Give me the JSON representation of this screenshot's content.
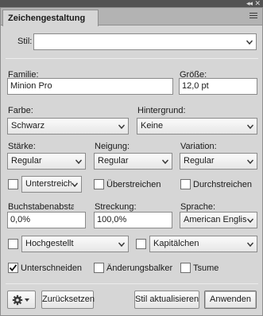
{
  "panel": {
    "title": "Zeichengestaltung"
  },
  "stil": {
    "label": "Stil:",
    "value": ""
  },
  "familie": {
    "label": "Familie:",
    "value": "Minion Pro"
  },
  "groesse": {
    "label": "Größe:",
    "value": "12,0 pt"
  },
  "farbe": {
    "label": "Farbe:",
    "value": "Schwarz"
  },
  "hintergrund": {
    "label": "Hintergrund:",
    "value": "Keine"
  },
  "staerke": {
    "label": "Stärke:",
    "value": "Regular"
  },
  "neigung": {
    "label": "Neigung:",
    "value": "Regular"
  },
  "variation": {
    "label": "Variation:",
    "value": "Regular"
  },
  "unterstreichen": {
    "checked": false,
    "value": "Unterstreich"
  },
  "ueberstreichen": {
    "checked": false,
    "label": "Überstreichen"
  },
  "durchstreichen": {
    "checked": false,
    "label": "Durchstreichen"
  },
  "buchstabenabstand": {
    "label": "Buchstabenabsta",
    "value": "0,0%"
  },
  "streckung": {
    "label": "Streckung:",
    "value": "100,0%"
  },
  "sprache": {
    "label": "Sprache:",
    "value": "American Englis"
  },
  "hochgestellt": {
    "checked": false,
    "value": "Hochgestellt"
  },
  "kapitaelchen": {
    "checked": false,
    "value": "Kapitälchen"
  },
  "unterschneiden": {
    "checked": true,
    "label": "Unterschneiden"
  },
  "aenderungsbalken": {
    "checked": false,
    "label": "Änderungsbalker"
  },
  "tsume": {
    "checked": false,
    "label": "Tsume"
  },
  "buttons": {
    "zuruecksetzen": "Zurücksetzen",
    "stil_aktualisieren": "Stil aktualisieren",
    "anwenden": "Anwenden"
  }
}
